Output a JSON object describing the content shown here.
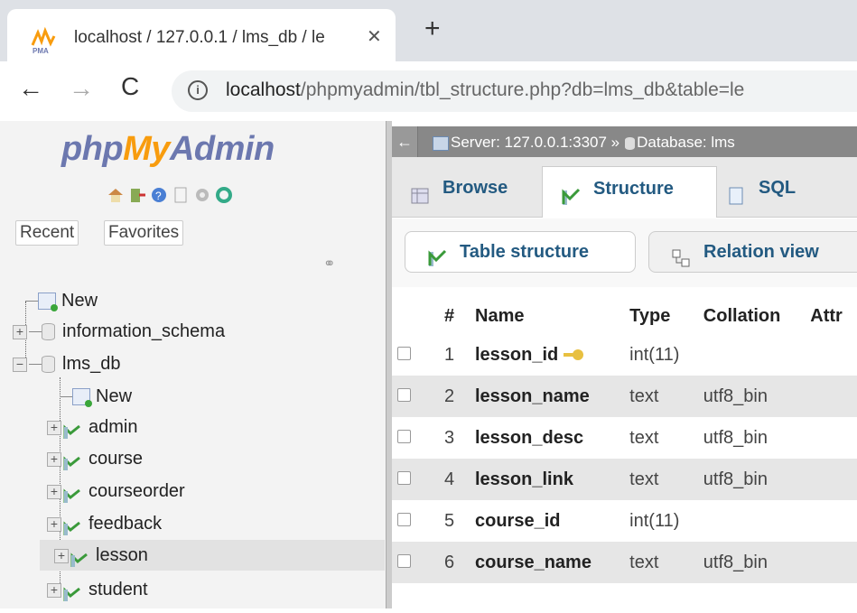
{
  "browser": {
    "tab_title": "localhost / 127.0.0.1 / lms_db / le",
    "tab_close": "✕",
    "new_tab": "+",
    "url_host": "localhost",
    "url_path": "/phpmyadmin/tbl_structure.php?db=lms_db&table=le",
    "back": "←",
    "forward": "→",
    "reload": "C",
    "info": "i"
  },
  "nav": {
    "logo_php": "php",
    "logo_my": "My",
    "logo_admin": "Admin",
    "recent": "Recent",
    "favorites": "Favorites",
    "tree": [
      {
        "label": "New"
      },
      {
        "label": "information_schema"
      },
      {
        "label": "lms_db"
      },
      {
        "label": "New"
      },
      {
        "label": "admin"
      },
      {
        "label": "course"
      },
      {
        "label": "courseorder"
      },
      {
        "label": "feedback"
      },
      {
        "label": "lesson"
      },
      {
        "label": "student"
      }
    ]
  },
  "main": {
    "breadcrumb_back": "←",
    "breadcrumb_server": "Server: 127.0.0.1:3307 »",
    "breadcrumb_db": "Database: lms",
    "tabs": [
      {
        "label": "Browse"
      },
      {
        "label": "Structure"
      },
      {
        "label": "SQL"
      }
    ],
    "subtabs": [
      {
        "label": "Table structure"
      },
      {
        "label": "Relation view"
      }
    ],
    "table": {
      "headers": [
        "#",
        "Name",
        "Type",
        "Collation",
        "Attr"
      ],
      "rows": [
        {
          "num": "1",
          "name": "lesson_id",
          "type": "int(11)",
          "collation": ""
        },
        {
          "num": "2",
          "name": "lesson_name",
          "type": "text",
          "collation": "utf8_bin"
        },
        {
          "num": "3",
          "name": "lesson_desc",
          "type": "text",
          "collation": "utf8_bin"
        },
        {
          "num": "4",
          "name": "lesson_link",
          "type": "text",
          "collation": "utf8_bin"
        },
        {
          "num": "5",
          "name": "course_id",
          "type": "int(11)",
          "collation": ""
        },
        {
          "num": "6",
          "name": "course_name",
          "type": "text",
          "collation": "utf8_bin"
        }
      ]
    }
  },
  "colors": {
    "pma_blue": "#6c78af",
    "pma_orange": "#f89c0e",
    "link_blue": "#235a81"
  }
}
